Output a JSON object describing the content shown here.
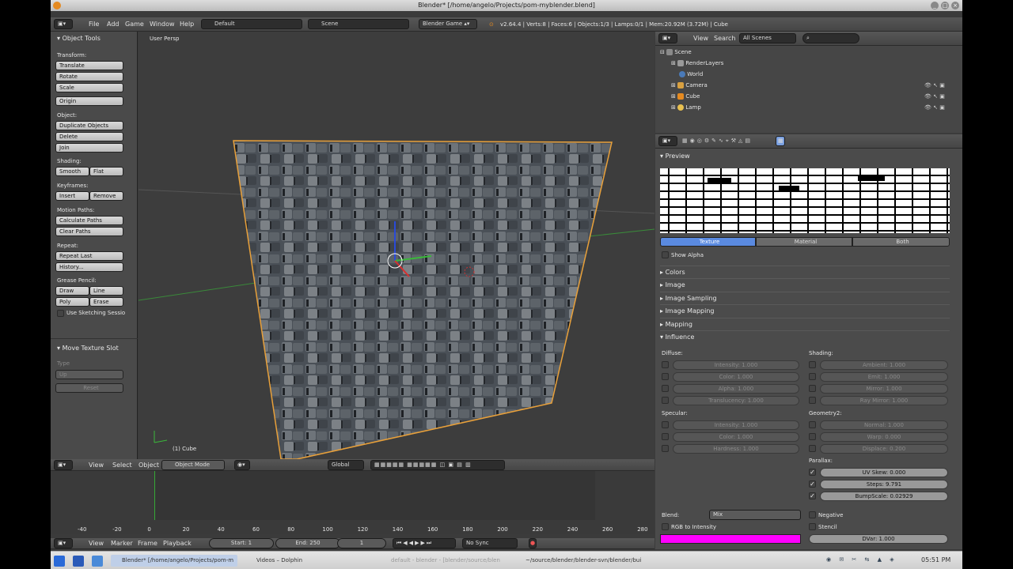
{
  "window": {
    "title": "Blender* [/home/angelo/Projects/pom-myblender.blend]"
  },
  "info_header": {
    "menus": [
      "File",
      "Add",
      "Game",
      "Window",
      "Help"
    ],
    "layout": "Default",
    "scene": "Scene",
    "engine": "Blender Game",
    "stats": "v2.64.4 | Verts:8 | Faces:6 | Objects:1/3 | Lamps:0/1 | Mem:20.92M (3.72M) | Cube"
  },
  "tool_shelf": {
    "title": "Object Tools",
    "transform_label": "Transform:",
    "translate": "Translate",
    "rotate": "Rotate",
    "scale": "Scale",
    "origin": "Origin",
    "object_label": "Object:",
    "duplicate": "Duplicate Objects",
    "delete": "Delete",
    "join": "Join",
    "shading_label": "Shading:",
    "smooth": "Smooth",
    "flat": "Flat",
    "keyframes_label": "Keyframes:",
    "insert": "Insert",
    "remove": "Remove",
    "motion_label": "Motion Paths:",
    "calc_paths": "Calculate Paths",
    "clear_paths": "Clear Paths",
    "repeat_label": "Repeat:",
    "repeat_last": "Repeat Last",
    "history": "History...",
    "grease_label": "Grease Pencil:",
    "draw": "Draw",
    "line": "Line",
    "poly": "Poly",
    "erase": "Erase",
    "sketching": "Use Sketching Sessio",
    "operator_title": "Move Texture Slot",
    "type_label": "Type",
    "type_value": "Up",
    "reset": "Reset"
  },
  "viewport": {
    "persp_label": "User Persp",
    "object_label": "(1) Cube",
    "menus": [
      "View",
      "Select",
      "Object"
    ],
    "mode": "Object Mode",
    "orientation": "Global"
  },
  "outliner": {
    "menus": [
      "View",
      "Search"
    ],
    "filter": "All Scenes",
    "items": [
      "Scene",
      "RenderLayers",
      "World",
      "Camera",
      "Cube",
      "Lamp"
    ]
  },
  "properties": {
    "preview_title": "Preview",
    "preview_tabs": [
      "Texture",
      "Material",
      "Both"
    ],
    "show_alpha": "Show Alpha",
    "panels": [
      "Colors",
      "Image",
      "Image Sampling",
      "Image Mapping",
      "Mapping"
    ],
    "influence_title": "Influence",
    "diffuse_label": "Diffuse:",
    "diffuse": [
      "Intensity: 1.000",
      "Color: 1.000",
      "Alpha: 1.000",
      "Translucency: 1.000"
    ],
    "shading_label": "Shading:",
    "shading": [
      "Ambient: 1.000",
      "Emit: 1.000",
      "Mirror: 1.000",
      "Ray Mirror: 1.000"
    ],
    "specular_label": "Specular:",
    "specular": [
      "Intensity: 1.000",
      "Color: 1.000",
      "Hardness: 1.000"
    ],
    "geometry_label": "Geometry2:",
    "geometry": [
      "Normal: 1.000",
      "Warp: 0.000",
      "Displace: 0.200"
    ],
    "parallax_label": "Parallax:",
    "parallax": [
      "UV Skew: 0.000",
      "Steps: 9.791",
      "BumpScale: 0.02929"
    ],
    "blend_label": "Blend:",
    "blend_value": "Mix",
    "negative": "Negative",
    "rgb_to_intensity": "RGB to Intensity",
    "stencil": "Stencil",
    "dvar": "DVar: 1.000",
    "color_swatch": "#ff00ff"
  },
  "timeline": {
    "ticks": [
      "-40",
      "-20",
      "0",
      "20",
      "40",
      "60",
      "80",
      "100",
      "120",
      "140",
      "160",
      "180",
      "200",
      "220",
      "240",
      "260",
      "280"
    ],
    "menus": [
      "View",
      "Marker",
      "Frame",
      "Playback"
    ],
    "start": "Start: 1",
    "end": "End: 250",
    "current": "1",
    "sync": "No Sync"
  },
  "taskbar": {
    "tasks": [
      "Blender* [/home/angelo/Projects/pom-m",
      "Videos – Dolphin",
      "default - blender - [blender/source/blen",
      "~/source/blender/blender-svn/blender/bui"
    ],
    "clock": "05:51 PM"
  }
}
